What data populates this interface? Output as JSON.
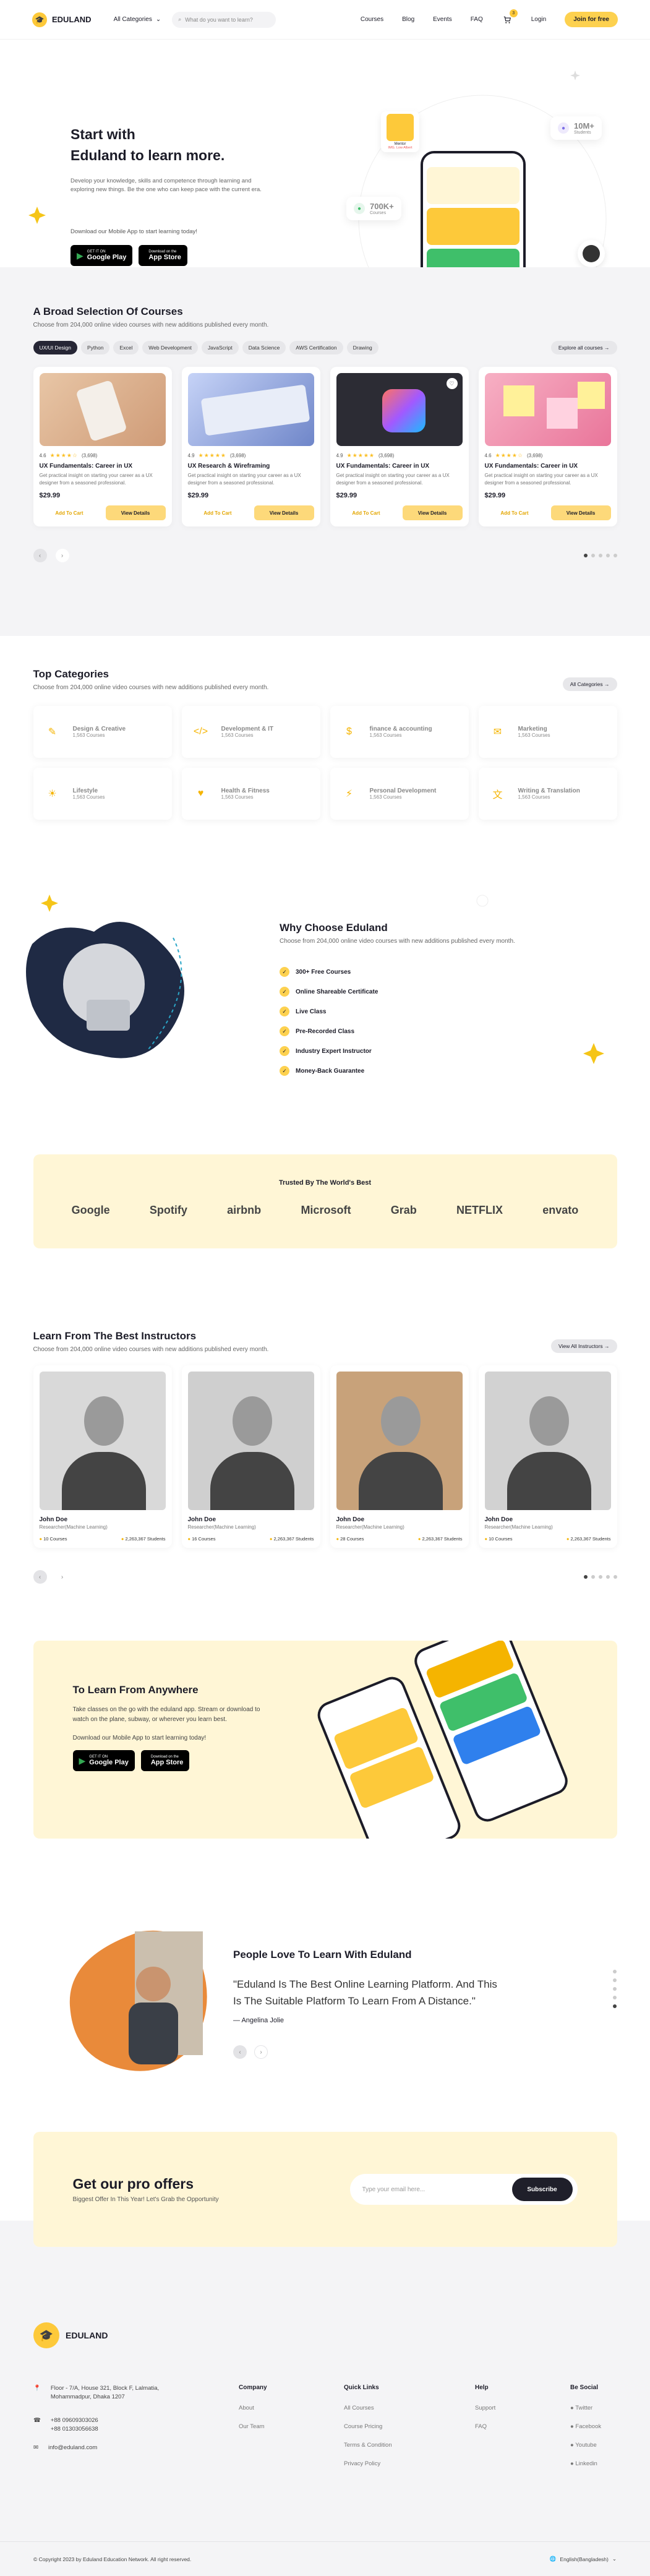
{
  "header": {
    "logo": "EDULAND",
    "category": "All Categories",
    "search_placeholder": "What do you want to learn?",
    "nav": [
      "Courses",
      "Blog",
      "Events",
      "FAQ"
    ],
    "cart_count": "3",
    "login": "Login",
    "join": "Join for free"
  },
  "hero": {
    "title1": "Start with",
    "title2": "Eduland to learn more.",
    "desc": "Develop your knowledge, skills and competence through learning and exploring new things. Be the one who can keep pace with the current era.",
    "download": "Download our Mobile App to start learning today!",
    "google_small": "GET IT ON",
    "google_big": "Google Play",
    "apple_small": "Download on the",
    "apple_big": "App Store",
    "stat1_value": "10M+",
    "stat1_label": "Students",
    "stat2_value": "700K+",
    "stat2_label": "Courses",
    "mentor_label": "Mentor",
    "mentor_name": "IMG. Low Albert"
  },
  "courses": {
    "title": "A Broad Selection Of Courses",
    "subtitle": "Choose from 204,000 online video courses with new additions published every month.",
    "chips": [
      "UX/UI Design",
      "Python",
      "Excel",
      "Web Development",
      "JavaScript",
      "Data Science",
      "AWS Certification",
      "Drawing"
    ],
    "explore": "Explore all courses",
    "cards": [
      {
        "rating": "4.6",
        "stars": "★★★★☆",
        "reviews": "(3,698)",
        "title": "UX Fundamentals: Career in UX",
        "desc": "Get practical insight on starting your career as a UX designer from a seasoned professional.",
        "price": "$29.99",
        "add": "Add To Cart",
        "view": "View Details"
      },
      {
        "rating": "4.9",
        "stars": "★★★★★",
        "reviews": "(3,698)",
        "title": "UX Research & Wireframing",
        "desc": "Get practical insight on starting your career as a UX designer from a seasoned professional.",
        "price": "$29.99",
        "add": "Add To Cart",
        "view": "View Details"
      },
      {
        "rating": "4.9",
        "stars": "★★★★★",
        "reviews": "(3,698)",
        "title": "UX Fundamentals: Career in UX",
        "desc": "Get practical insight on starting your career as a UX designer from a seasoned professional.",
        "price": "$29.99",
        "add": "Add To Cart",
        "view": "View Details"
      },
      {
        "rating": "4.6",
        "stars": "★★★★☆",
        "reviews": "(3,698)",
        "title": "UX Fundamentals: Career in UX",
        "desc": "Get practical insight on starting your career as a UX designer from a seasoned professional.",
        "price": "$29.99",
        "add": "Add To Cart",
        "view": "View Details"
      }
    ]
  },
  "categories": {
    "title": "Top Categories",
    "subtitle": "Choose from 204,000 online video courses with new additions published every month.",
    "all": "All Categories",
    "items": [
      {
        "name": "Design & Creative",
        "count": "1,563 Courses",
        "icon": "design-icon",
        "glyph": "✎"
      },
      {
        "name": "Development & IT",
        "count": "1,563 Courses",
        "icon": "code-icon",
        "glyph": "</>"
      },
      {
        "name": "finance & accounting",
        "count": "1,563 Courses",
        "icon": "finance-icon",
        "glyph": "$"
      },
      {
        "name": "Marketing",
        "count": "1,563 Courses",
        "icon": "megaphone-icon",
        "glyph": "✉"
      },
      {
        "name": "Lifestyle",
        "count": "1,563 Courses",
        "icon": "lifestyle-icon",
        "glyph": "☀"
      },
      {
        "name": "Health & Fitness",
        "count": "1,563 Courses",
        "icon": "health-icon",
        "glyph": "♥"
      },
      {
        "name": "Personal Development",
        "count": "1,563 Courses",
        "icon": "growth-icon",
        "glyph": "⚡"
      },
      {
        "name": "Writing & Translation",
        "count": "1,563 Courses",
        "icon": "translate-icon",
        "glyph": "文"
      }
    ]
  },
  "why": {
    "title": "Why Choose Eduland",
    "subtitle": "Choose from 204,000 online video courses with new additions published every month.",
    "items": [
      "300+ Free Courses",
      "Online Shareable Certificate",
      "Live Class",
      "Pre-Recorded Class",
      "Industry Expert Instructor",
      "Money-Back Guarantee"
    ]
  },
  "trusted": {
    "title": "Trusted By The World's Best",
    "brands": [
      "Google",
      "Spotify",
      "airbnb",
      "Microsoft",
      "Grab",
      "NETFLIX",
      "envato"
    ]
  },
  "instructors": {
    "title": "Learn From The Best Instructors",
    "subtitle": "Choose from 204,000 online video courses with new additions published every month.",
    "all": "View All Instructors",
    "items": [
      {
        "name": "John Doe",
        "role": "Researcher(Machine Learning)",
        "courses": "10 Courses",
        "students": "2,263,367 Students"
      },
      {
        "name": "John Doe",
        "role": "Researcher(Machine Learning)",
        "courses": "16 Courses",
        "students": "2,263,367 Students"
      },
      {
        "name": "John Doe",
        "role": "Researcher(Machine Learning)",
        "courses": "28 Courses",
        "students": "2,263,367 Students"
      },
      {
        "name": "John Doe",
        "role": "Researcher(Machine Learning)",
        "courses": "10 Courses",
        "students": "2,263,367 Students"
      }
    ]
  },
  "app": {
    "title": "To Learn From Anywhere",
    "desc": "Take classes on the go with the eduland app. Stream or download to watch on the plane, subway, or wherever you learn best.",
    "download": "Download our Mobile App to start learning today!"
  },
  "testimonial": {
    "title": "People Love To Learn With Eduland",
    "quote": "\"Eduland Is The Best Online Learning Platform. And This Is The Suitable Platform To Learn From A Distance.\"",
    "author": "Angelina Jolie"
  },
  "pro": {
    "title": "Get our pro offers",
    "subtitle": "Biggest Offer In This Year! Let's Grab the Opportunity",
    "placeholder": "Type your email here...",
    "button": "Subscribe"
  },
  "footer": {
    "logo": "EDULAND",
    "address": "Floor - 7/A, House 321, Block F, Lalmatia, Mohammadpur, Dhaka 1207",
    "phone1": "+88 09609303026",
    "phone2": "+88 01303056638",
    "email": "info@eduland.com",
    "company_title": "Company",
    "company": [
      "About",
      "Our Team"
    ],
    "quick_title": "Quick Links",
    "quick": [
      "All Courses",
      "Course Pricing",
      "Terms & Condition",
      "Privacy Policy"
    ],
    "help_title": "Help",
    "help": [
      "Support",
      "FAQ"
    ],
    "social_title": "Be Social",
    "social": [
      "Twitter",
      "Facebook",
      "Youtube",
      "Linkedin"
    ],
    "copyright": "© Copyright 2023 by Eduland Education Network. All right reserved.",
    "language": "English(Bangladesh)"
  },
  "colors": {
    "accent": "#fdd14f",
    "dark": "#1c1c28",
    "cream": "#fff6d6"
  }
}
